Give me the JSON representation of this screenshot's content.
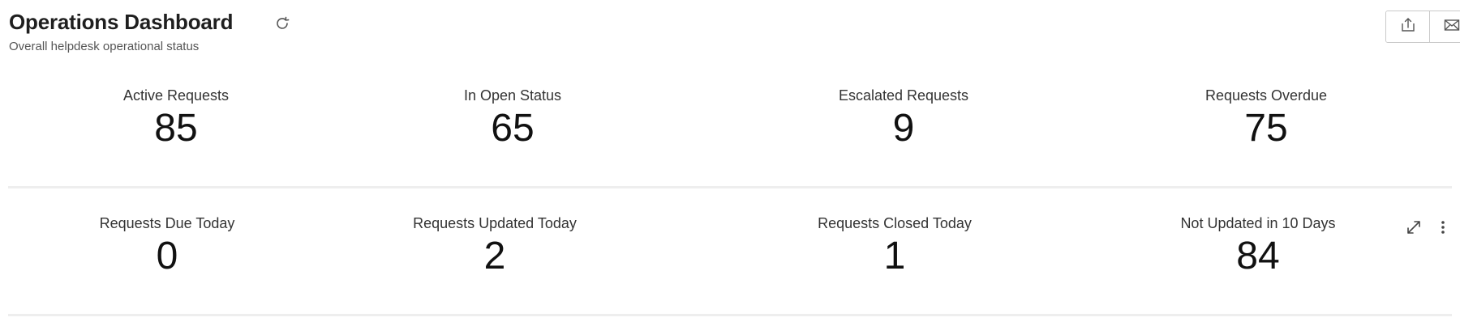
{
  "header": {
    "title": "Operations Dashboard",
    "subtitle": "Overall helpdesk operational status",
    "refresh_icon": "refresh-icon",
    "toolbar_icons": [
      "export-icon",
      "email-icon"
    ]
  },
  "rows": [
    {
      "kpis": [
        {
          "label": "Active Requests",
          "value": "85"
        },
        {
          "label": "In Open Status",
          "value": "65"
        },
        {
          "label": "Escalated Requests",
          "value": "9"
        },
        {
          "label": "Requests Overdue",
          "value": "75"
        }
      ]
    },
    {
      "kpis": [
        {
          "label": "Requests Due Today",
          "value": "0"
        },
        {
          "label": "Requests Updated Today",
          "value": "2"
        },
        {
          "label": "Requests Closed Today",
          "value": "1"
        },
        {
          "label": "Not Updated in 10 Days",
          "value": "84"
        }
      ],
      "widget_action_icons": [
        "expand-icon",
        "more-options-icon"
      ]
    }
  ],
  "colors": {
    "divider": "#eeeeee",
    "text": "#111111",
    "subtitle": "#555555"
  }
}
